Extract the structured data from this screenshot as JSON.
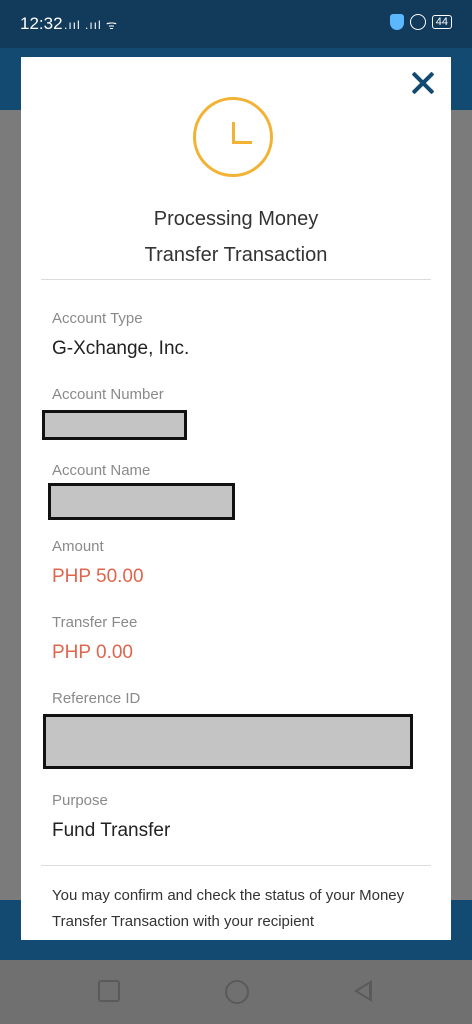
{
  "status_bar": {
    "time": "12:32",
    "signals": ".ııl .ııl ᯤ",
    "battery": "44"
  },
  "modal": {
    "title_line1": "Processing Money",
    "title_line2": "Transfer Transaction",
    "fields": {
      "account_type_label": "Account Type",
      "account_type_value": "G-Xchange, Inc.",
      "account_number_label": "Account Number",
      "account_name_label": "Account Name",
      "amount_label": "Amount",
      "amount_value": "PHP 50.00",
      "transfer_fee_label": "Transfer Fee",
      "transfer_fee_value": "PHP 0.00",
      "reference_id_label": "Reference ID",
      "purpose_label": "Purpose",
      "purpose_value": "Fund Transfer"
    },
    "footnote": "You may confirm and check the status of your Money Transfer Transaction with your recipient"
  },
  "colors": {
    "primary": "#134a72",
    "accent_clock": "#f2b233",
    "amount_red": "#e0654d"
  },
  "icons": [
    "close-icon",
    "clock-icon",
    "shield-icon",
    "lock-icon",
    "battery-icon",
    "nav-recents-icon",
    "nav-home-icon",
    "nav-back-icon"
  ]
}
